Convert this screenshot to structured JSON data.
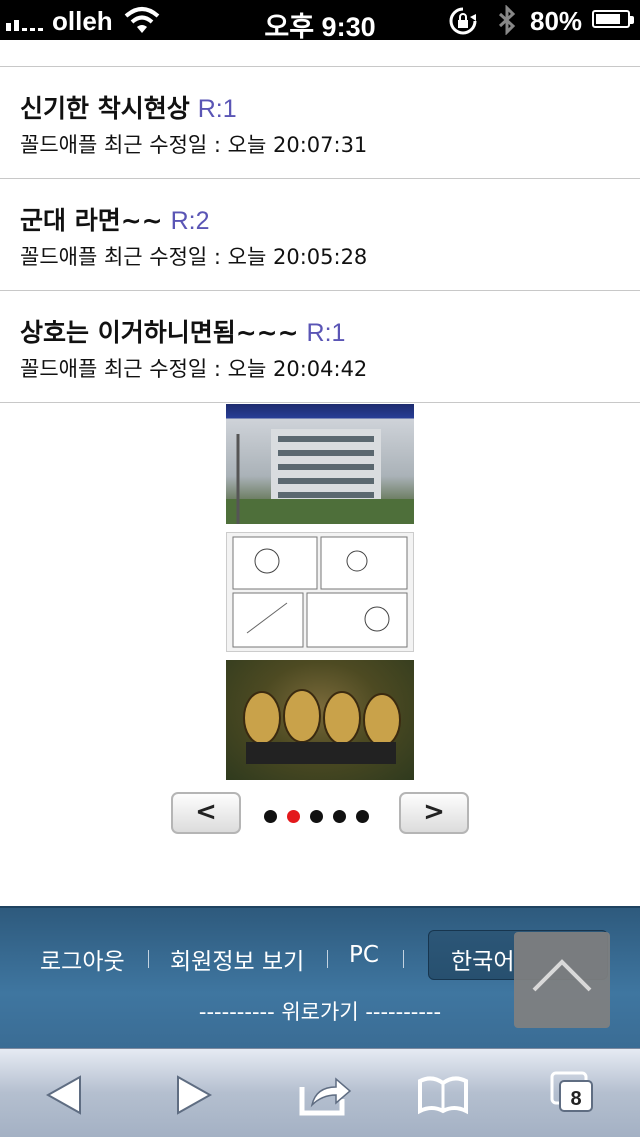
{
  "status_bar": {
    "carrier": "olleh",
    "time": "오후 9:30",
    "battery": "80%",
    "battery_level": 0.8
  },
  "posts": [
    {
      "title": "신기한 착시현상",
      "reply": "R:1",
      "meta": "꼴드애플 최근 수정일 : 오늘 20:07:31"
    },
    {
      "title": "군대 라면~~",
      "reply": "R:2",
      "meta": "꼴드애플 최근 수정일 : 오늘 20:05:28"
    },
    {
      "title": "상호는 이거하니면됨~~~",
      "reply": "R:1",
      "meta": "꼴드애플 최근 수정일 : 오늘 20:04:42"
    }
  ],
  "pager": {
    "prev_label": "<",
    "next_label": ">",
    "page_count": 5,
    "active_page": 2
  },
  "footer": {
    "logout": "로그아웃",
    "member_info": "회원정보 보기",
    "pc": "PC",
    "language": "한국어",
    "go_top": "---------- 위로가기 ----------"
  },
  "toolbar": {
    "tabs_count": "8"
  },
  "colors": {
    "reply_accent": "#5a55b5",
    "active_dot": "#e3191c",
    "footer_bg": "#3a6c94"
  }
}
